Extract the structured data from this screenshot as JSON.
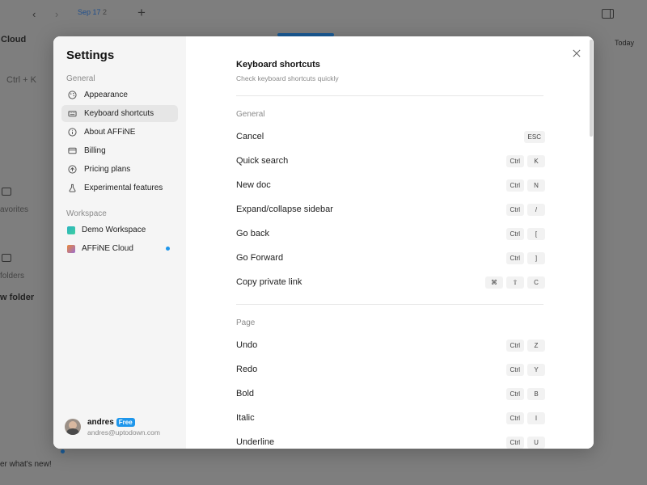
{
  "background": {
    "tab_label": "Sep 17",
    "tab_suffix": "2",
    "sidebar_cloud": "Cloud",
    "search_hint": "Ctrl + K",
    "favorites": "avorites",
    "folders": "folders",
    "new_folder": "w folder",
    "whats_new": "er what's new!",
    "today": "Today"
  },
  "settings": {
    "title": "Settings",
    "general_label": "General",
    "general_items": [
      {
        "label": "Appearance",
        "icon": "palette-icon"
      },
      {
        "label": "Keyboard shortcuts",
        "icon": "keyboard-icon",
        "active": true
      },
      {
        "label": "About AFFiNE",
        "icon": "info-icon"
      },
      {
        "label": "Billing",
        "icon": "credit-card-icon"
      },
      {
        "label": "Pricing plans",
        "icon": "upgrade-icon"
      },
      {
        "label": "Experimental features",
        "icon": "flask-icon"
      }
    ],
    "workspace_label": "Workspace",
    "workspaces": [
      {
        "label": "Demo Workspace",
        "color": "#2bb3c0"
      },
      {
        "label": "AFFiNE Cloud",
        "color": "#e8873a",
        "unread": true
      }
    ],
    "user": {
      "name": "andres",
      "plan_badge": "Free",
      "email": "andres@uptodown.com"
    }
  },
  "shortcuts": {
    "title": "Keyboard shortcuts",
    "subtitle": "Check keyboard shortcuts quickly",
    "sections": [
      {
        "label": "General",
        "items": [
          {
            "label": "Cancel",
            "keys": [
              "ESC"
            ]
          },
          {
            "label": "Quick search",
            "keys": [
              "Ctrl",
              "K"
            ]
          },
          {
            "label": "New doc",
            "keys": [
              "Ctrl",
              "N"
            ]
          },
          {
            "label": "Expand/collapse sidebar",
            "keys": [
              "Ctrl",
              "/"
            ]
          },
          {
            "label": "Go back",
            "keys": [
              "Ctrl",
              "["
            ]
          },
          {
            "label": "Go Forward",
            "keys": [
              "Ctrl",
              "]"
            ]
          },
          {
            "label": "Copy private link",
            "keys": [
              "⌘",
              "⇧",
              "C"
            ]
          }
        ]
      },
      {
        "label": "Page",
        "items": [
          {
            "label": "Undo",
            "keys": [
              "Ctrl",
              "Z"
            ]
          },
          {
            "label": "Redo",
            "keys": [
              "Ctrl",
              "Y"
            ]
          },
          {
            "label": "Bold",
            "keys": [
              "Ctrl",
              "B"
            ]
          },
          {
            "label": "Italic",
            "keys": [
              "Ctrl",
              "I"
            ]
          },
          {
            "label": "Underline",
            "keys": [
              "Ctrl",
              "U"
            ]
          }
        ]
      }
    ]
  },
  "colors": {
    "accent": "#1e96eb",
    "overlay": "#7e7e7e"
  }
}
